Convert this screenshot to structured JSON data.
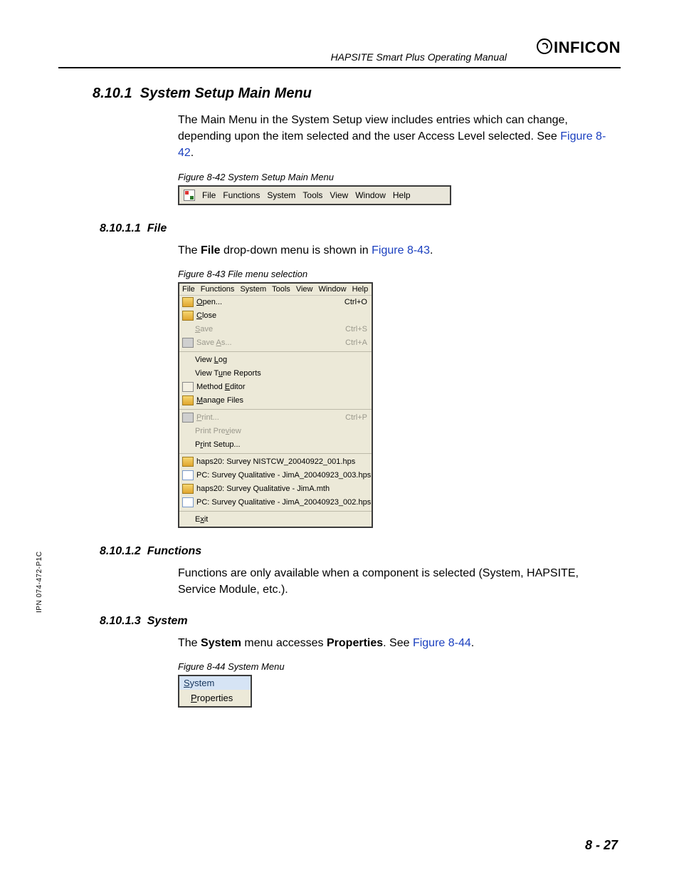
{
  "header": {
    "running_title": "HAPSITE Smart Plus Operating Manual",
    "brand": "INFICON"
  },
  "ipn": "IPN 074-472-P1C",
  "page_number": "8 - 27",
  "sections": {
    "s1": {
      "number": "8.10.1",
      "title": "System Setup Main Menu",
      "para1_a": "The Main Menu in the System Setup view includes entries which can change, depending upon the item selected and the user Access Level selected. See ",
      "para1_link": "Figure 8-42",
      "para1_b": "."
    },
    "fig42": {
      "caption": "Figure 8-42  System Setup Main Menu",
      "menus": [
        "File",
        "Functions",
        "System",
        "Tools",
        "View",
        "Window",
        "Help"
      ]
    },
    "s11": {
      "number": "8.10.1.1",
      "title": "File",
      "para_a": "The ",
      "para_bold": "File",
      "para_b": " drop-down menu is shown in ",
      "para_link": "Figure 8-43",
      "para_c": "."
    },
    "fig43": {
      "caption": "Figure 8-43  File menu selection",
      "bar": [
        "File",
        "Functions",
        "System",
        "Tools",
        "View",
        "Window",
        "Help"
      ],
      "groups": [
        [
          {
            "icon": "ico-open",
            "u": "O",
            "label": "pen...",
            "accel": "Ctrl+O",
            "disabled": false
          },
          {
            "icon": "ico-close",
            "u": "C",
            "label": "lose",
            "accel": "",
            "disabled": false
          },
          {
            "icon": "",
            "u": "S",
            "label": "ave",
            "accel": "Ctrl+S",
            "disabled": true
          },
          {
            "icon": "ico-save",
            "u": "",
            "label": "Save ",
            "u2": "A",
            "label2": "s...",
            "accel": "Ctrl+A",
            "disabled": true
          }
        ],
        [
          {
            "icon": "",
            "u": "",
            "label": "View ",
            "u2": "L",
            "label2": "og",
            "accel": "",
            "disabled": false
          },
          {
            "icon": "",
            "u": "",
            "label": "View T",
            "u2": "u",
            "label2": "ne Reports",
            "accel": "",
            "disabled": false
          },
          {
            "icon": "ico-edit",
            "u": "",
            "label": "Method ",
            "u2": "E",
            "label2": "ditor",
            "accel": "",
            "disabled": false
          },
          {
            "icon": "ico-folder",
            "u": "M",
            "label": "anage Files",
            "accel": "",
            "disabled": false
          }
        ],
        [
          {
            "icon": "ico-print",
            "u": "P",
            "label": "rint...",
            "accel": "Ctrl+P",
            "disabled": true
          },
          {
            "icon": "",
            "u": "",
            "label": "Print Pre",
            "u2": "v",
            "label2": "iew",
            "accel": "",
            "disabled": true
          },
          {
            "icon": "",
            "u": "",
            "label": "P",
            "u2": "r",
            "label2": "int Setup...",
            "accel": "",
            "disabled": false
          }
        ],
        [
          {
            "icon": "ico-folder",
            "u": "",
            "label": "haps20: Survey NISTCW_20040922_001.hps",
            "accel": "",
            "disabled": false
          },
          {
            "icon": "ico-doc",
            "u": "",
            "label": "PC: Survey Qualitative - JimA_20040923_003.hps",
            "accel": "",
            "disabled": false
          },
          {
            "icon": "ico-folder",
            "u": "",
            "label": "haps20: Survey Qualitative - JimA.mth",
            "accel": "",
            "disabled": false
          },
          {
            "icon": "ico-doc",
            "u": "",
            "label": "PC: Survey Qualitative - JimA_20040923_002.hps",
            "accel": "",
            "disabled": false
          }
        ],
        [
          {
            "icon": "",
            "u": "",
            "label": "E",
            "u2": "x",
            "label2": "it",
            "accel": "",
            "disabled": false
          }
        ]
      ]
    },
    "s12": {
      "number": "8.10.1.2",
      "title": "Functions",
      "para": "Functions are only available when a component is selected (System, HAPSITE, Service Module, etc.)."
    },
    "s13": {
      "number": "8.10.1.3",
      "title": "System",
      "para_a": "The ",
      "para_bold1": "System",
      "para_b": " menu accesses ",
      "para_bold2": "Properties",
      "para_c": ". See ",
      "para_link": "Figure 8-44",
      "para_d": "."
    },
    "fig44": {
      "caption": "Figure 8-44  System Menu",
      "top_u": "S",
      "top": "ystem",
      "row_u": "P",
      "row": "roperties"
    }
  }
}
